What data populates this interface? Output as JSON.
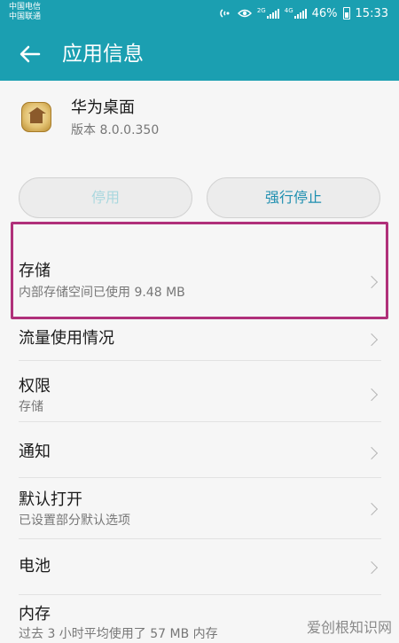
{
  "status_bar": {
    "carrier_1": "中国电信",
    "carrier_2": "中国联通",
    "network_1": "2G",
    "network_2": "4G",
    "battery": "46%",
    "time": "15:33",
    "icons": [
      "nfc-icon",
      "eye-comfort-icon",
      "signal-icon",
      "battery-icon"
    ]
  },
  "app_bar": {
    "back_icon": "arrow-left-icon",
    "title": "应用信息"
  },
  "app": {
    "name": "华为桌面",
    "version": "版本 8.0.0.350",
    "icon": "huawei-launcher-app-icon"
  },
  "buttons": {
    "disable": "停用",
    "force_stop": "强行停止"
  },
  "settings": [
    {
      "id": "storage",
      "title": "存储",
      "subtitle": "内部存储空间已使用 9.48 MB"
    },
    {
      "id": "data-usage",
      "title": "流量使用情况",
      "subtitle": ""
    },
    {
      "id": "permissions",
      "title": "权限",
      "subtitle": "存储"
    },
    {
      "id": "notifications",
      "title": "通知",
      "subtitle": ""
    },
    {
      "id": "open-by-default",
      "title": "默认打开",
      "subtitle": "已设置部分默认选项"
    },
    {
      "id": "battery",
      "title": "电池",
      "subtitle": ""
    },
    {
      "id": "memory",
      "title": "内存",
      "subtitle": "过去 3 小时平均使用了 57 MB 内存"
    }
  ],
  "watermark": "爱创根知识网",
  "colors": {
    "primary": "#1b9fb1",
    "highlight": "#b0307a",
    "force_stop_text": "#1f8fb0"
  }
}
